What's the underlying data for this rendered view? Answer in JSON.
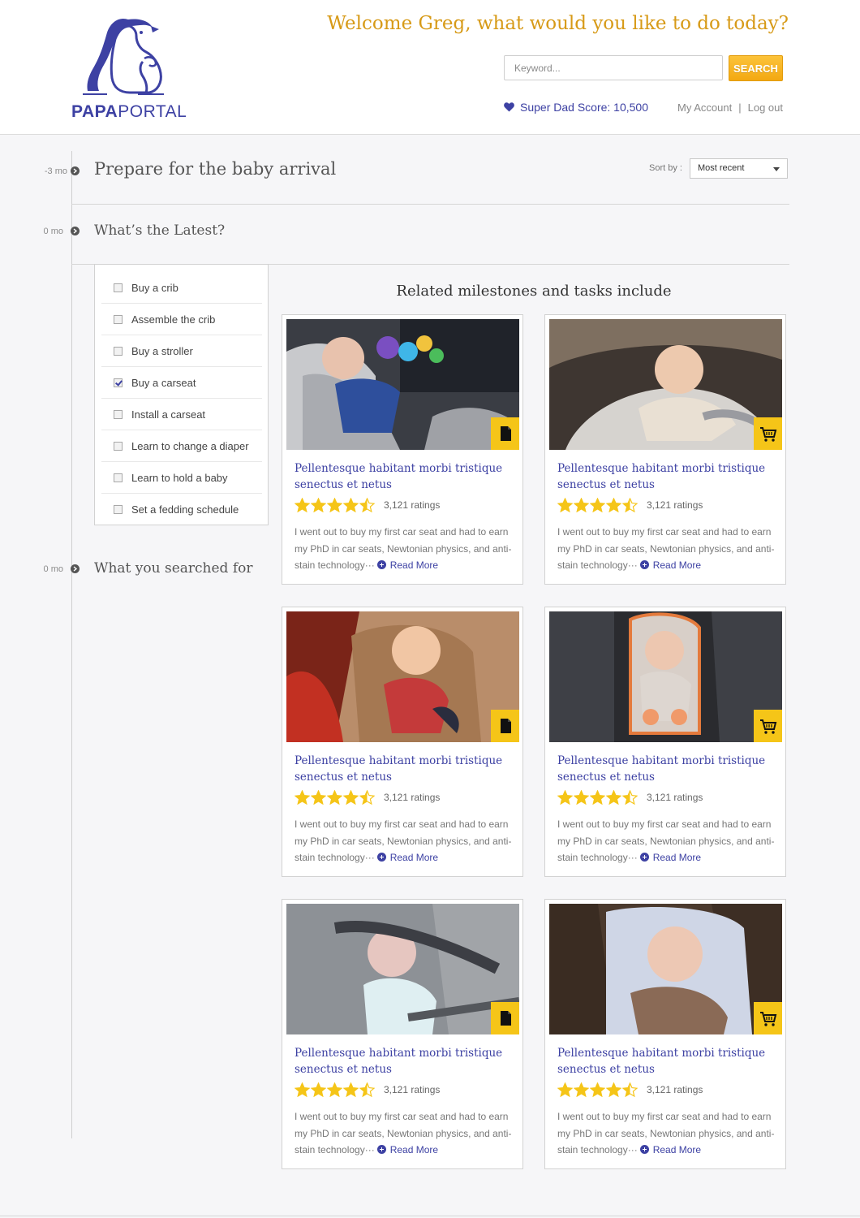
{
  "header": {
    "logo_text_bold": "PAPA",
    "logo_text_light": "PORTAL",
    "welcome": "Welcome Greg, what would you like to do today?",
    "search_placeholder": "Keyword...",
    "search_label": "SEARCH",
    "score_label": "Super Dad Score: 10,500",
    "my_account": "My Account",
    "separator": "|",
    "logout": "Log out"
  },
  "timeline": [
    {
      "when": "-3 mo",
      "title": "Prepare for the baby arrival"
    },
    {
      "when": "0 mo",
      "title": "What’s the Latest?"
    },
    {
      "when": "0 mo",
      "title": "What you searched for"
    }
  ],
  "sort": {
    "label": "Sort by :",
    "value": "Most recent"
  },
  "checklist": [
    {
      "label": "Buy a crib",
      "checked": false
    },
    {
      "label": "Assemble the crib",
      "checked": false
    },
    {
      "label": "Buy a stroller",
      "checked": false
    },
    {
      "label": "Buy a carseat",
      "checked": true
    },
    {
      "label": "Install a carseat",
      "checked": false
    },
    {
      "label": "Learn to change a diaper",
      "checked": false
    },
    {
      "label": "Learn to hold a baby",
      "checked": false
    },
    {
      "label": "Set a fedding schedule",
      "checked": false
    }
  ],
  "related_title": "Related milestones and tasks include",
  "cards": [
    {
      "title": "Pellentesque habitant morbi tristique senectus et netus",
      "rating": 4.5,
      "ratings_text": "3,121 ratings",
      "desc": "I went out to buy my first car seat and had to earn my PhD in car seats, Newtonian physics, and anti-stain technology···",
      "read_more": "Read More",
      "badge": "document-icon"
    },
    {
      "title": "Pellentesque habitant morbi tristique senectus et netus",
      "rating": 4.5,
      "ratings_text": "3,121 ratings",
      "desc": "I went out to buy my first car seat and had to earn my PhD in car seats, Newtonian physics, and anti-stain technology···",
      "read_more": "Read More",
      "badge": "cart-icon"
    },
    {
      "title": "Pellentesque habitant morbi tristique senectus et netus",
      "rating": 4.5,
      "ratings_text": "3,121 ratings",
      "desc": "I went out to buy my first car seat and had to earn my PhD in car seats, Newtonian physics, and anti-stain technology···",
      "read_more": "Read More",
      "badge": "document-icon"
    },
    {
      "title": "Pellentesque habitant morbi tristique senectus et netus",
      "rating": 4.5,
      "ratings_text": "3,121 ratings",
      "desc": "I went out to buy my first car seat and had to earn my PhD in car seats, Newtonian physics, and anti-stain technology···",
      "read_more": "Read More",
      "badge": "cart-icon"
    },
    {
      "title": "Pellentesque habitant morbi tristique senectus et netus",
      "rating": 4.5,
      "ratings_text": "3,121 ratings",
      "desc": "I went out to buy my first car seat and had to earn my PhD in car seats, Newtonian physics, and anti-stain technology···",
      "read_more": "Read More",
      "badge": "document-icon"
    },
    {
      "title": "Pellentesque habitant morbi tristique senectus et netus",
      "rating": 4.5,
      "ratings_text": "3,121 ratings",
      "desc": "I went out to buy my first car seat and had to earn my PhD in car seats, Newtonian physics, and anti-stain technology···",
      "read_more": "Read More",
      "badge": "cart-icon"
    }
  ],
  "colors": {
    "brand": "#3d41a3",
    "accent": "#d79a17",
    "button": "#f5b323",
    "star": "#f5c518"
  }
}
